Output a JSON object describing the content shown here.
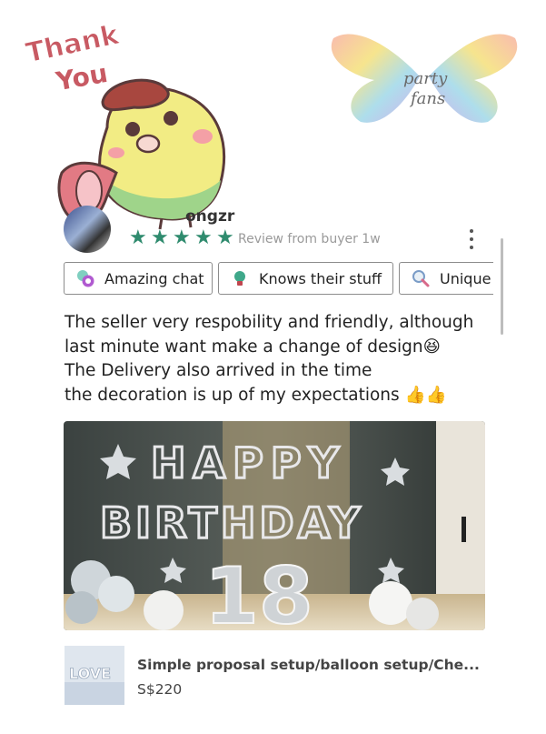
{
  "sticker": {
    "text_line1": "Thank",
    "text_line2": "You"
  },
  "logo": {
    "line1": "party",
    "line2": "fans"
  },
  "review": {
    "username": "ongzr",
    "rating": 5,
    "meta": "Review from buyer 1w",
    "tags": [
      {
        "label": "Amazing chat",
        "icon": "chat-bubbles-icon"
      },
      {
        "label": "Knows their stuff",
        "icon": "lightbulb-icon"
      },
      {
        "label": "Unique",
        "icon": "magnifier-icon"
      }
    ],
    "text_lines": [
      "The seller very respobility and friendly, although",
      "last minute want make a change of design😆",
      "The Delivery also arrived in the time",
      "the decoration is up of my expectations 👍👍"
    ]
  },
  "photo": {
    "balloon_text_1": "HAPPY",
    "balloon_text_2": "BIRTHDAY",
    "balloon_number": "18"
  },
  "product": {
    "thumb_text": "LOVE",
    "title": "Simple proposal setup/balloon setup/Che...",
    "price": "S$220"
  },
  "colors": {
    "star": "#2f8b6e",
    "text": "#222222",
    "muted": "#9a9a9a",
    "border": "#8c8c8c"
  }
}
